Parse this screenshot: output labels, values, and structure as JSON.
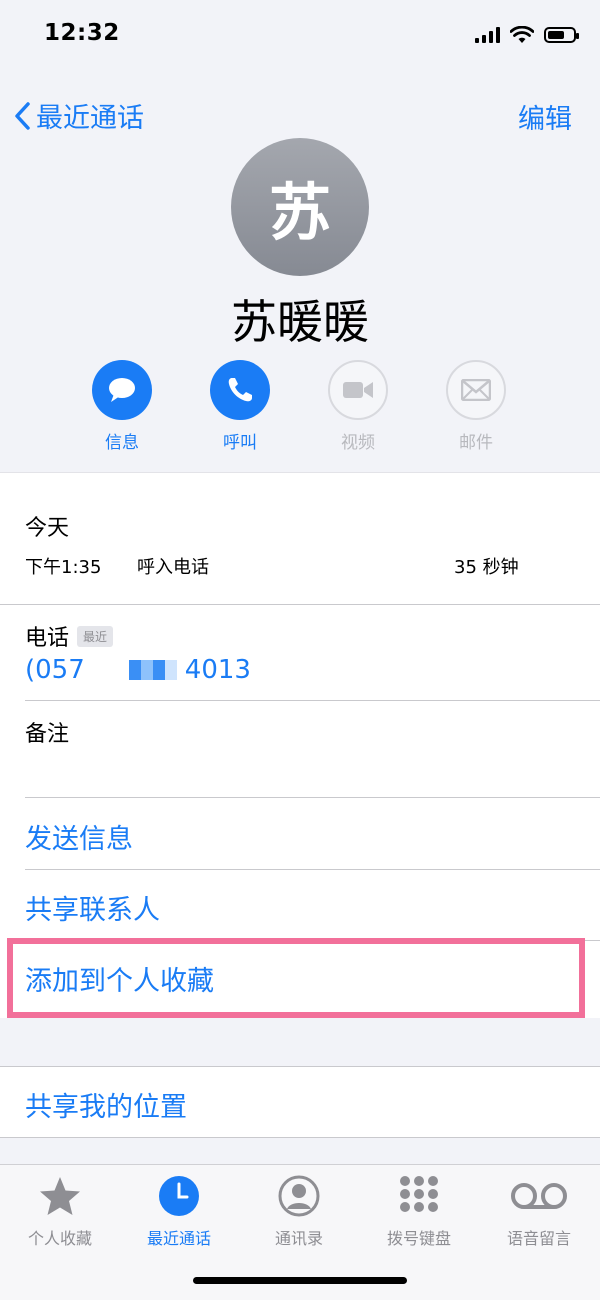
{
  "status": {
    "time": "12:32"
  },
  "nav": {
    "back_label": "最近通话",
    "edit_label": "编辑"
  },
  "contact": {
    "avatar_initial": "苏",
    "name": "苏暖暖"
  },
  "actions": [
    {
      "label": "信息",
      "icon": "message-bubble-icon",
      "enabled": true
    },
    {
      "label": "呼叫",
      "icon": "phone-icon",
      "enabled": true
    },
    {
      "label": "视频",
      "icon": "video-camera-icon",
      "enabled": false
    },
    {
      "label": "邮件",
      "icon": "mail-envelope-icon",
      "enabled": false
    }
  ],
  "recent": {
    "day": "今天",
    "time": "下午1:35",
    "type": "呼入电话",
    "duration": "35 秒钟"
  },
  "phone": {
    "label": "电话",
    "badge": "最近",
    "number_prefix": "(057",
    "number_suffix": "4013"
  },
  "notes": {
    "label": "备注"
  },
  "links": {
    "send_message": "发送信息",
    "share_contact": "共享联系人",
    "add_favorite": "添加到个人收藏",
    "share_location": "共享我的位置"
  },
  "tabbar": [
    {
      "label": "个人收藏",
      "icon": "star-icon",
      "active": false
    },
    {
      "label": "最近通话",
      "icon": "clock-icon",
      "active": true
    },
    {
      "label": "通讯录",
      "icon": "person-circle-icon",
      "active": false
    },
    {
      "label": "拨号键盘",
      "icon": "keypad-icon",
      "active": false
    },
    {
      "label": "语音留言",
      "icon": "voicemail-icon",
      "active": false
    }
  ],
  "colors": {
    "accent": "#1a7cf5",
    "highlight": "#f2709a",
    "disabled": "#b8b9be"
  }
}
